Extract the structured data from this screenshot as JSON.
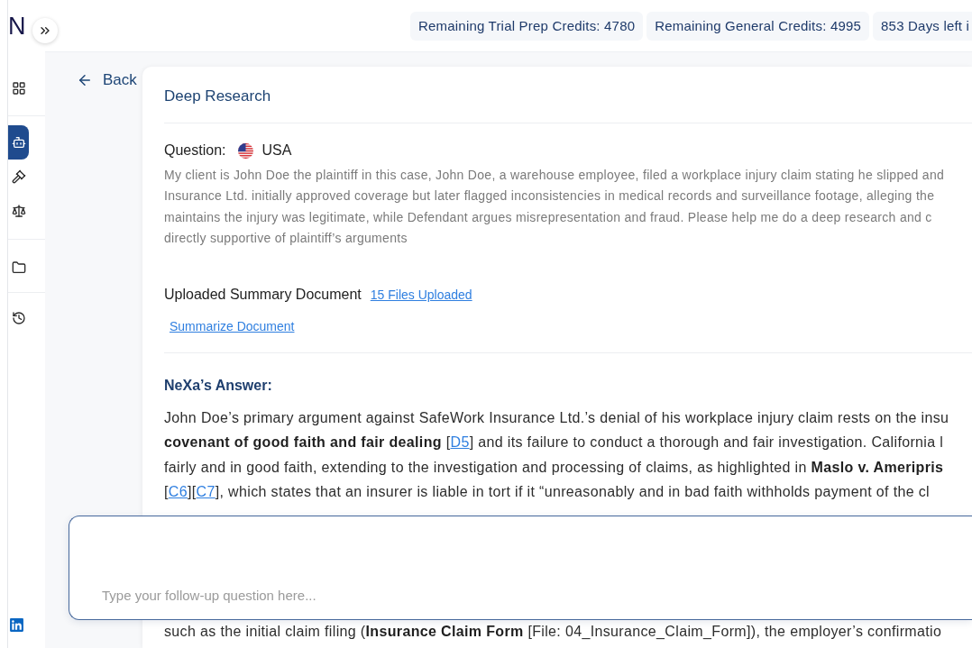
{
  "sidebar": {
    "logo": "N",
    "groups": [
      {
        "items": [
          {
            "selected": false
          }
        ]
      },
      {
        "items": [
          {
            "selected": true
          },
          {
            "selected": false
          },
          {
            "selected": false
          }
        ]
      },
      {
        "items": [
          {
            "selected": false
          }
        ]
      },
      {
        "items": [
          {
            "selected": false
          }
        ]
      }
    ]
  },
  "header": {
    "credits": [
      "Remaining Trial Prep Credits: 4780",
      "Remaining General Credits: 4995",
      "853 Days left i"
    ]
  },
  "back": "Back",
  "research": {
    "title": "Deep Research",
    "question": {
      "label": "Question:",
      "jurisdiction": "USA",
      "lines": [
        "My client is John Doe the plaintiff in this case, John Doe, a warehouse employee, filed a workplace injury claim stating he slipped and",
        "Insurance Ltd. initially approved coverage but later flagged inconsistencies in medical records and surveillance footage, alleging the",
        "maintains the injury was legitimate, while Defendant argues misrepresentation and fraud. Please help me do a deep research and c",
        "directly supportive of plaintiff’s arguments"
      ]
    },
    "upload": {
      "label": "Uploaded Summary Document",
      "files_link": "15 Files Uploaded",
      "summarize_link": "Summarize Document"
    },
    "answer": {
      "heading": "NeXa’s Answer:",
      "lines": [
        [
          {
            "kind": "text",
            "text": "John Doe’s primary argument against SafeWork Insurance Ltd.’s denial of his workplace injury claim rests on the insu"
          }
        ],
        [
          {
            "kind": "text",
            "text": "**covenant of good faith and fair dealing** ["
          },
          {
            "kind": "citation",
            "text": "D5"
          },
          {
            "kind": "text",
            "text": "] and its failure to conduct a thorough and fair investigation. California l"
          }
        ],
        [
          {
            "kind": "text",
            "text": "fairly and in good faith, extending to the investigation and processing of claims, as highlighted in **Maslo v. Ameripris**"
          }
        ],
        [
          {
            "kind": "text",
            "text": "["
          },
          {
            "kind": "citation",
            "text": "C6"
          },
          {
            "kind": "text",
            "text": "]["
          },
          {
            "kind": "citation",
            "text": "C7"
          },
          {
            "kind": "text",
            "text": "], which states that an insurer is liable in tort if it “unreasonably and in bad faith withholds payment of the cl"
          }
        ]
      ],
      "lower_line": [
        {
          "kind": "text",
          "text": "such as the initial claim filing (**Insurance Claim Form** [File: 04_Insurance_Claim_Form]), the employer’s confirmatio"
        }
      ]
    }
  },
  "follow_up": {
    "placeholder": "Type your follow-up question here..."
  }
}
